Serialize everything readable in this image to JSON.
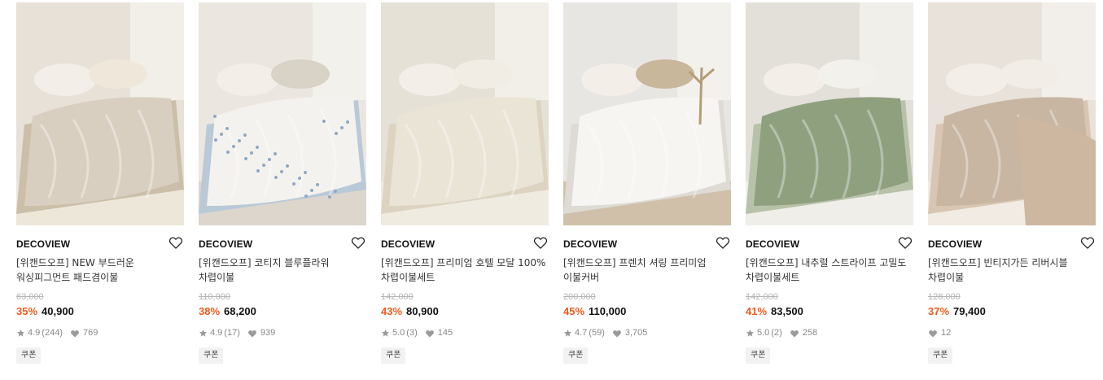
{
  "products": [
    {
      "brand": "DECOVIEW",
      "title": "[위캔드오프] NEW 부드러운 워싱피그먼트 패드겸이불",
      "original_price": "63,000",
      "discount": "35%",
      "price": "40,900",
      "rating": "4.9",
      "review_count": "(244)",
      "likes": "769",
      "coupon": "쿠폰",
      "image": "beige quilted mattress pad with knit throw",
      "palette": [
        "#e7e1d7",
        "#d9cfc0",
        "#cbbfa9",
        "#efe8da"
      ]
    },
    {
      "brand": "DECOVIEW",
      "title": "[위캔드오프] 코티지 블루플라워 차렵이불",
      "original_price": "110,000",
      "discount": "38%",
      "price": "68,200",
      "rating": "4.9",
      "review_count": "(17)",
      "likes": "939",
      "coupon": "쿠폰",
      "image": "white floral comforter with blue blossoms",
      "palette": [
        "#ebe7e0",
        "#f4f2ee",
        "#b9c9d8",
        "#d8d2c7"
      ]
    },
    {
      "brand": "DECOVIEW",
      "title": "[위캔드오프] 프리미엄 호텔 모달 100% 차렵이불세트",
      "original_price": "142,000",
      "discount": "43%",
      "price": "80,900",
      "rating": "5.0",
      "review_count": "(3)",
      "likes": "145",
      "coupon": "쿠폰",
      "image": "cream modal hotel comforter set",
      "palette": [
        "#e6e1d7",
        "#eae4d6",
        "#dcd3c1",
        "#f1ede4"
      ]
    },
    {
      "brand": "DECOVIEW",
      "title": "[위캔드오프] 프렌치 셔링 프리미엄 이불커버",
      "original_price": "200,000",
      "discount": "45%",
      "price": "110,000",
      "rating": "4.7",
      "review_count": "(59)",
      "likes": "3,705",
      "coupon": "쿠폰",
      "image": "white shirred duvet cover with pampas grass",
      "palette": [
        "#e8e6e2",
        "#f6f5f2",
        "#dedbd5",
        "#c9b79b"
      ]
    },
    {
      "brand": "DECOVIEW",
      "title": "[위캔드오프] 내추럴 스트라이프 고밀도 차렵이불세트",
      "original_price": "142,000",
      "discount": "41%",
      "price": "83,500",
      "rating": "5.0",
      "review_count": "(2)",
      "likes": "258",
      "coupon": "쿠폰",
      "image": "sage green striped comforter set",
      "palette": [
        "#e3e0da",
        "#8fa07f",
        "#b7c2a8",
        "#f3f1ec"
      ]
    },
    {
      "brand": "DECOVIEW",
      "title": "[위캔드오프] 빈티지가든 리버시블 차렵이불",
      "original_price": "128,000",
      "discount": "37%",
      "price": "79,400",
      "rating": "",
      "review_count": "",
      "likes": "12",
      "coupon": "쿠폰",
      "image": "vintage garden reversible comforter with beige throw",
      "palette": [
        "#e8e2da",
        "#c8b5a2",
        "#d9c6b2",
        "#f2ede6"
      ]
    }
  ],
  "colors": {
    "discount": "#ee5b1d",
    "strike": "#b5b5b5",
    "muted": "#888888",
    "coupon_bg": "#f2f2f2"
  },
  "icons": {
    "wishlist": "heart-outline-icon",
    "rating": "star-icon",
    "likes": "heart-filled-icon"
  }
}
